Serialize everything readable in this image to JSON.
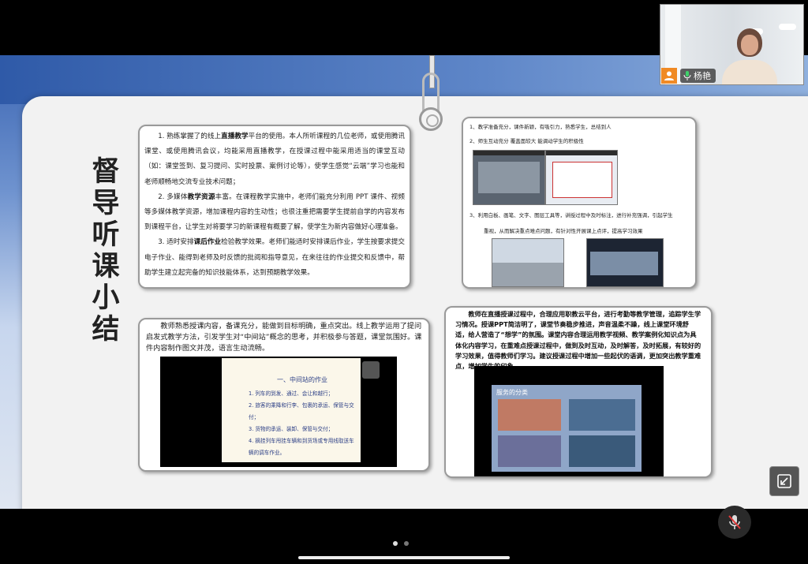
{
  "participant": {
    "name": "杨艳"
  },
  "slide": {
    "title": "督导听课小结",
    "panel1": {
      "para1_intro": "1.  熟练掌握了的线上",
      "para1_bold": "直播教学",
      "para1_rest": "平台的使用。本人所听课程的几位老师，或使用腾讯课堂、或使用腾讯会议，均能采用直播教学，在授课过程中能采用适当的课堂互动（如：课堂签到、复习提问、实时投票、案例讨论等），使学生感觉“云端”学习也能和老师顺畅地交流专业技术问题；",
      "para2_intro": "2.  多媒体",
      "para2_bold": "教学资源",
      "para2_rest": "丰富。在课程教学实施中，老师们能充分利用 PPT 课件、视频等多媒体教学资源，增加课程内容的生动性；也很注重把需要学生提前自学的内容发布到课程平台，让学生对将要学习的新课程有概要了解，使学生为新内容做好心理准备。",
      "para3_intro": "3.  适时安排",
      "para3_bold": "课后作业",
      "para3_rest": "检验教学效果。老师们能适时安排课后作业，学生按要求提交电子作业、能得到老师及时反馈的批阅和指导意见，在来往往的作业提交和反馈中，帮助学生建立起完备的知识技能体系，达到预期教学效果。"
    },
    "panel2": {
      "line1": "1、教学准备充分，课件新颖，有吸引力，熟悉学生，总结到人",
      "line2": "2、师生互动充分      覆盖面较大      能调动学生的积极性",
      "line3": "3、利用白板、画笔、文字、图层工具等，讲授过程中及时标注，进行补充强调，引起学生",
      "line4": "重视，从而解决重点难点问题，有针对性开展课上点评，提高学习效果"
    },
    "panel3": {
      "text": "教师熟悉授课内容，备课充分，能做到目标明确，重点突出。线上教学运用了提问启发式教学方法，引发学生对“中间站”概念的思考，并积极参与答题，课堂氛围好。课件内容制作图文并茂，语言生动流畅。",
      "screen_header": "一、中间站的作业",
      "screen_items": [
        "1. 列车的到发、通过、会让和越行；",
        "2. 旅客的乘降和行李、包裹的承运、保管与交付；",
        "3. 货物的承运、装卸、保管与交付；",
        "4. 摘挂列车甩挂车辆和到货场或专用线取送车辆的调车作业。"
      ]
    },
    "panel4": {
      "text": "教师在直播授课过程中，合理应用职教云平台，进行考勤等教学管理，追踪学生学习情况。授课PPT简洁明了，课堂节奏稳步推进，声音温柔不躁，线上课堂环境舒适，给人营造了“想学”的氛围。课堂内容合理运用教学视频、教学案例化知识点为具体化内容学习，在重难点授课过程中，做到及时互动，及时解答，及时拓展，有较好的学习效果，值得教师们学习。建议授课过程中增加一些起伏的语调，更加突出教学重难点，增加学生的印象。",
      "screen_header": "服务的分类"
    }
  },
  "icons": {
    "avatar": "person-icon",
    "mic": "microphone-icon",
    "fullscreen": "exit-fullscreen-icon",
    "mute": "microphone-muted-icon"
  },
  "colors": {
    "slide_blue": "#3c66b3",
    "avatar_orange": "#f08a24"
  },
  "pager": {
    "count": 2,
    "current": 1
  }
}
